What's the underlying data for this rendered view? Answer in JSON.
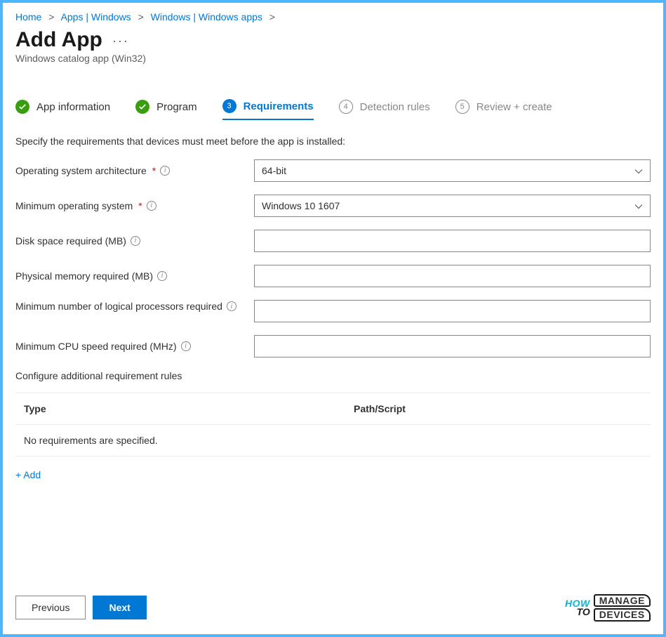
{
  "breadcrumb": {
    "items": [
      "Home",
      "Apps | Windows",
      "Windows | Windows apps"
    ]
  },
  "header": {
    "title": "Add App",
    "subtitle": "Windows catalog app (Win32)"
  },
  "steps": [
    {
      "label": "App information",
      "state": "done",
      "badge": "✓"
    },
    {
      "label": "Program",
      "state": "done",
      "badge": "✓"
    },
    {
      "label": "Requirements",
      "state": "active",
      "badge": "3"
    },
    {
      "label": "Detection rules",
      "state": "pending",
      "badge": "4"
    },
    {
      "label": "Review + create",
      "state": "pending",
      "badge": "5"
    }
  ],
  "form": {
    "description": "Specify the requirements that devices must meet before the app is installed:",
    "fields": {
      "arch": {
        "label": "Operating system architecture",
        "required": true,
        "value": "64-bit"
      },
      "minos": {
        "label": "Minimum operating system",
        "required": true,
        "value": "Windows 10 1607"
      },
      "disk": {
        "label": "Disk space required (MB)",
        "required": false,
        "value": ""
      },
      "mem": {
        "label": "Physical memory required (MB)",
        "required": false,
        "value": ""
      },
      "cpu_count": {
        "label": "Minimum number of logical processors required",
        "required": false,
        "value": ""
      },
      "cpu_speed": {
        "label": "Minimum CPU speed required (MHz)",
        "required": false,
        "value": ""
      }
    },
    "additional_label": "Configure additional requirement rules",
    "table": {
      "cols": [
        "Type",
        "Path/Script"
      ],
      "empty": "No requirements are specified."
    },
    "add_link": "+ Add"
  },
  "footer": {
    "previous": "Previous",
    "next": "Next"
  },
  "watermark": {
    "how": "HOW",
    "to": "TO",
    "manage": "MANAGE",
    "devices": "DEVICES"
  }
}
